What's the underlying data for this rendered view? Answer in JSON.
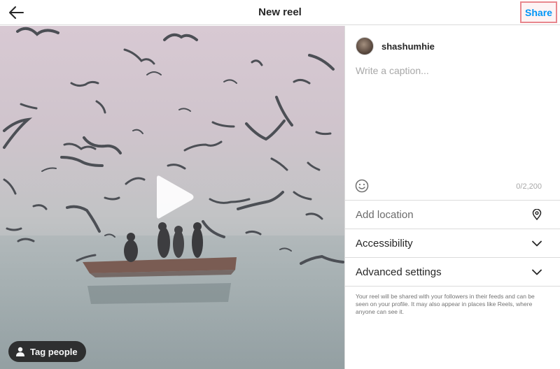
{
  "header": {
    "title": "New reel",
    "share_label": "Share"
  },
  "media": {
    "tag_people_label": "Tag people"
  },
  "panel": {
    "username": "shashumhie",
    "caption_placeholder": "Write a caption...",
    "caption_value": "",
    "char_count": "0/2,200",
    "add_location_label": "Add location",
    "accessibility_label": "Accessibility",
    "advanced_settings_label": "Advanced settings",
    "info_text": "Your reel will be shared with your followers in their feeds and can be seen on your profile. It may also appear in places like Reels, where anyone can see it."
  },
  "colors": {
    "accent": "#0095f6",
    "share_highlight_border": "#e8878e"
  },
  "icons": [
    "back-arrow-icon",
    "play-icon",
    "person-icon",
    "emoji-icon",
    "location-pin-icon",
    "chevron-down-icon"
  ]
}
